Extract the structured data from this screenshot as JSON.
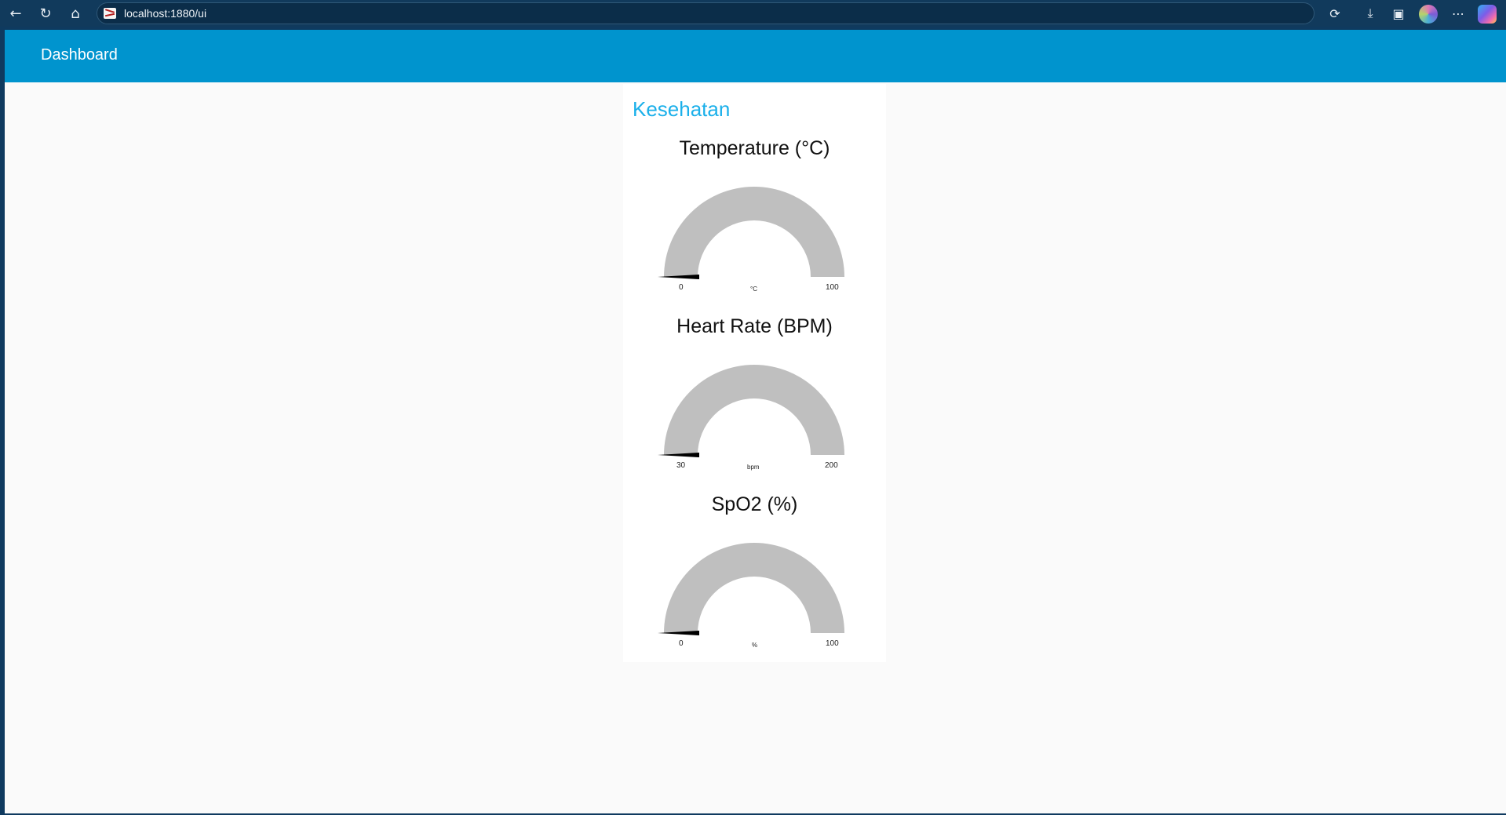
{
  "browser": {
    "url": "localhost:1880/ui",
    "icons": [
      "back-icon",
      "reload-icon",
      "home-icon",
      "extensions-icon",
      "downloads-icon",
      "screenshot-icon",
      "more-icon"
    ]
  },
  "toolbar": {
    "title": "Dashboard",
    "color": "#0094ce"
  },
  "group": {
    "title": "Kesehatan",
    "title_color": "#1bb0ea",
    "gauges": [
      {
        "title": "Temperature (°C)",
        "min": "0",
        "max": "100",
        "unit": "°C",
        "value_fraction": 0
      },
      {
        "title": "Heart Rate (BPM)",
        "min": "30",
        "max": "200",
        "unit": "bpm",
        "value_fraction": 0
      },
      {
        "title": "SpO2 (%)",
        "min": "0",
        "max": "100",
        "unit": "%",
        "value_fraction": 0
      }
    ],
    "track_color": "#bfbfbf",
    "needle_color": "#000000"
  }
}
